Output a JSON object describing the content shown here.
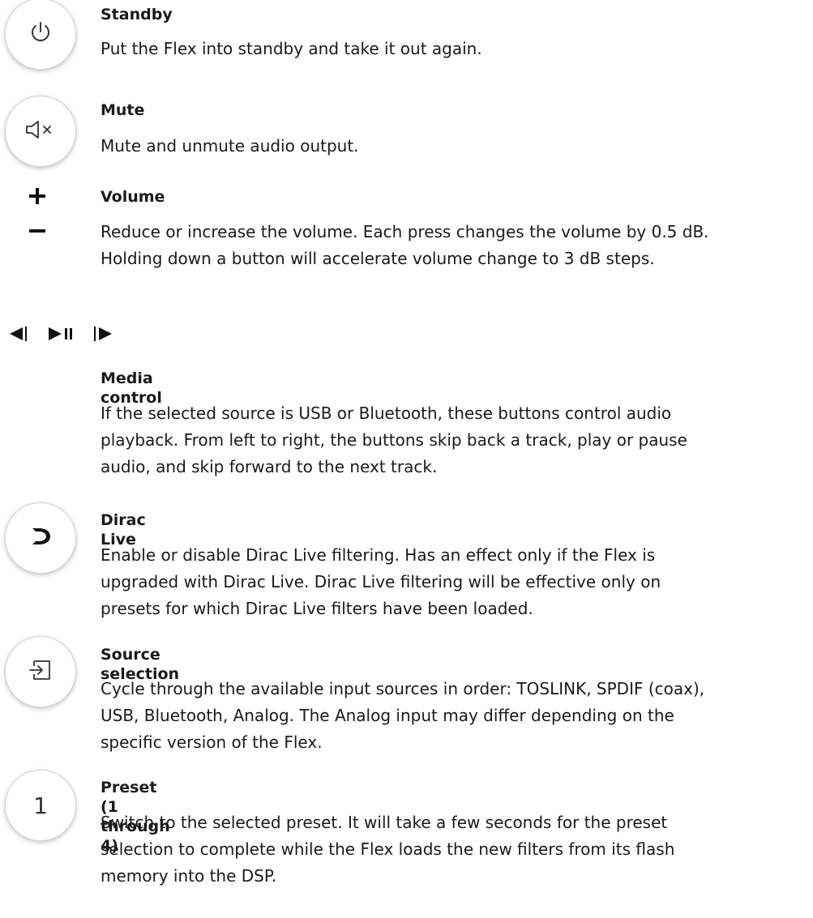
{
  "standby": {
    "title": "Standby",
    "description": "Put the Flex into standby and take it out again.",
    "icon": "power-icon"
  },
  "mute": {
    "title": "Mute",
    "description": "Mute and unmute audio output.",
    "icon": "speaker-mute-icon"
  },
  "volume": {
    "title": "Volume",
    "description_line1": "Reduce or increase the volume. Each press changes the volume by 0.5 dB.",
    "description_line2": "Holding down a button will accelerate volume change to 3 dB steps.",
    "icons": [
      "plus-icon",
      "minus-icon"
    ]
  },
  "media": {
    "title": "Media control",
    "description_line1": "If the selected source is USB or Bluetooth, these buttons control audio",
    "description_line2": "playback. From left to right, the buttons skip back a track, play or pause",
    "description_line3": "audio, and skip forward to the next track.",
    "icons": [
      "skip-back-icon",
      "play-pause-icon",
      "skip-forward-icon"
    ]
  },
  "dirac": {
    "title": "Dirac Live",
    "description_line1": "Enable or disable Dirac Live filtering. Has an effect only if the Flex is",
    "description_line2": "upgraded with Dirac Live. Dirac Live filtering will be effective only on",
    "description_line3": "presets for which Dirac Live filters have been loaded.",
    "icon": "dirac-logo-icon"
  },
  "source": {
    "title": "Source selection",
    "description_line1": "Cycle through the available input sources in order: TOSLINK, SPDIF (coax),",
    "description_line2": "USB, Bluetooth, Analog. The Analog input may differ depending on the",
    "description_line3": "specific version of the Flex.",
    "icon": "input-source-icon"
  },
  "preset": {
    "title": "Preset (1 through 4)",
    "icon_label": "1",
    "description_line1": "Switch to the selected preset. It will take a few seconds for the preset",
    "description_line2": "selection to complete while the Flex loads the new filters from its flash",
    "description_line3": "memory into the DSP."
  }
}
